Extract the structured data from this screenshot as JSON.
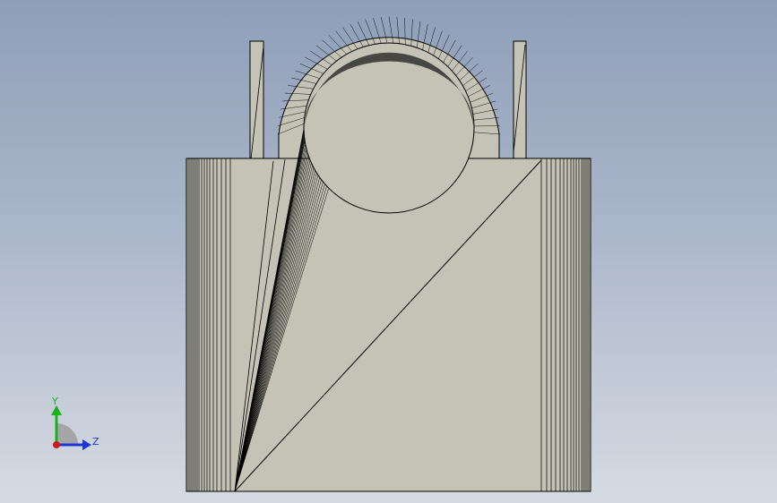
{
  "viewport": {
    "background_top": "#8f9fb9",
    "background_bottom": "#d6dbe3"
  },
  "model": {
    "face_color": "#c4c3b5",
    "edge_color": "#000000"
  },
  "triad": {
    "y_label": "Y",
    "z_label": "Z",
    "y_color": "#19b319",
    "z_color": "#1f35d6",
    "x_color": "#d21a1a"
  }
}
